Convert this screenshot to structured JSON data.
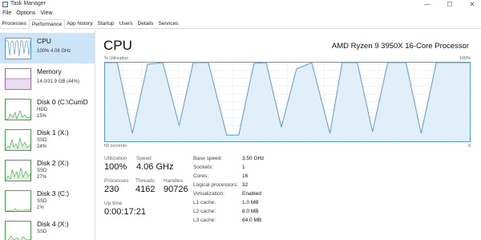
{
  "window": {
    "title": "Task Manager",
    "minimize": "—",
    "maximize": "☐",
    "close": "✕"
  },
  "menu": [
    "File",
    "Options",
    "View"
  ],
  "tabs": [
    "Processes",
    "Performance",
    "App history",
    "Startup",
    "Users",
    "Details",
    "Services"
  ],
  "active_tab": "Performance",
  "sidebar": {
    "items": [
      {
        "title": "CPU",
        "lines": [
          "100%  4.06 GHz"
        ],
        "kind": "cpu",
        "selected": true
      },
      {
        "title": "Memory",
        "lines": [
          "14.0/31.9 GB (44%)"
        ],
        "kind": "mem"
      },
      {
        "title": "Disk 0 (C:\\CumD",
        "lines": [
          "HDD",
          "15%"
        ],
        "kind": "disk"
      },
      {
        "title": "Disk 1 (X:)",
        "lines": [
          "SSD",
          "24%"
        ],
        "kind": "disk"
      },
      {
        "title": "Disk 2 (X:)",
        "lines": [
          "SSD",
          "27%"
        ],
        "kind": "disk"
      },
      {
        "title": "Disk 3 (C:)",
        "lines": [
          "SSD",
          "1%"
        ],
        "kind": "disk"
      },
      {
        "title": "Disk 4 (X:)",
        "lines": [
          "SSD"
        ],
        "kind": "disk"
      }
    ]
  },
  "main": {
    "heading": "CPU",
    "model": "AMD Ryzen 9 3950X 16-Core Processor",
    "graph": {
      "top_left": "% Utilization",
      "top_right": "100%",
      "bottom_left": "60 seconds",
      "bottom_right": "0"
    },
    "stats": {
      "utilization_label": "Utilization",
      "utilization_value": "100%",
      "speed_label": "Speed",
      "speed_value": "4.06 GHz",
      "processes_label": "Processes",
      "processes_value": "230",
      "threads_label": "Threads",
      "threads_value": "4162",
      "handles_label": "Handles",
      "handles_value": "90726",
      "uptime_label": "Up time",
      "uptime_value": "0:00:17:21"
    },
    "details": [
      {
        "label": "Base speed:",
        "value": "3.50 GHz"
      },
      {
        "label": "Sockets:",
        "value": "1"
      },
      {
        "label": "Cores:",
        "value": "16"
      },
      {
        "label": "Logical processors:",
        "value": "32"
      },
      {
        "label": "Virtualization:",
        "value": "Enabled"
      },
      {
        "label": "L1 cache:",
        "value": "1.0 MB"
      },
      {
        "label": "L2 cache:",
        "value": "8.0 MB"
      },
      {
        "label": "L3 cache:",
        "value": "64.0 MB"
      }
    ]
  },
  "chart_data": {
    "type": "area",
    "ylabel": "% Utilization",
    "ylim": [
      0,
      100
    ],
    "xlim": [
      60,
      0
    ],
    "x": [
      60,
      58,
      55.5,
      53,
      50.5,
      47.8,
      45.5,
      43,
      40,
      38,
      35.5,
      33.5,
      31,
      28.5,
      26,
      23,
      21,
      18.5,
      16,
      13.5,
      10.5,
      8,
      5.5,
      3,
      0.5,
      0
    ],
    "values": [
      100,
      100,
      10,
      98,
      100,
      20,
      100,
      100,
      8,
      8,
      99,
      100,
      18,
      92,
      100,
      10,
      100,
      100,
      12,
      100,
      100,
      10,
      100,
      100,
      100,
      100
    ],
    "grid": true,
    "colors": {
      "line": "#5b9bd5",
      "fill": "#dcecf8",
      "grid": "#e3edf6"
    }
  },
  "colors": {
    "selected_bg": "#cce4f7",
    "cpu": "#5b9bd5",
    "memory": "#a56ab5",
    "disk": "#4da14d"
  }
}
